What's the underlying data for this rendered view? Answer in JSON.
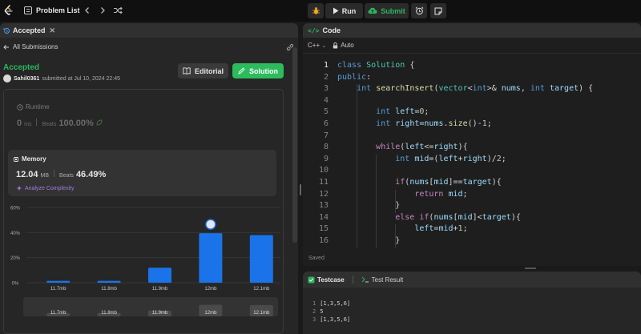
{
  "topbar": {
    "problem_list": "Problem List",
    "run_label": "Run",
    "submit_label": "Submit"
  },
  "left": {
    "tab_label": "Accepted",
    "all_submissions": "All Submissions",
    "status": "Accepted",
    "username": "Sahil0361",
    "submitted_text": "submitted at Jul 10, 2024 22:45",
    "editorial_label": "Editorial",
    "solution_label": "Solution",
    "runtime": {
      "label": "Runtime",
      "value": "0",
      "unit": "ms",
      "beats_label": "Beats",
      "beats_value": "100.00%"
    },
    "memory": {
      "label": "Memory",
      "value": "12.04",
      "unit": "MB",
      "beats_label": "Beats",
      "beats_value": "46.49%",
      "analyze": "Analyze Complexity"
    }
  },
  "chart_data": {
    "type": "bar",
    "categories": [
      "11.7mb",
      "11.8mb",
      "11.9mb",
      "12mb",
      "12.1mb"
    ],
    "values": [
      1.5,
      1.5,
      12,
      39.5,
      38
    ],
    "y_ticks": [
      "60%",
      "40%",
      "20%",
      "0%"
    ],
    "ylim": [
      0,
      60
    ],
    "highlight_index": 3,
    "bar_color": "#1a73e8",
    "grid": true
  },
  "code_panel": {
    "tab_label": "Code",
    "language": "C++",
    "mode": "Auto",
    "saved": "Saved",
    "lines": [
      {
        "n": "1",
        "text": "class Solution {"
      },
      {
        "n": "2",
        "text": "public:"
      },
      {
        "n": "3",
        "text": "    int searchInsert(vector<int>& nums, int target) {"
      },
      {
        "n": "4",
        "text": ""
      },
      {
        "n": "5",
        "text": "        int left=0;"
      },
      {
        "n": "6",
        "text": "        int right=nums.size()-1;"
      },
      {
        "n": "7",
        "text": ""
      },
      {
        "n": "8",
        "text": "        while(left<=right){"
      },
      {
        "n": "9",
        "text": "            int mid=(left+right)/2;"
      },
      {
        "n": "10",
        "text": ""
      },
      {
        "n": "11",
        "text": "            if(nums[mid]==target){"
      },
      {
        "n": "12",
        "text": "                return mid;"
      },
      {
        "n": "13",
        "text": "            }"
      },
      {
        "n": "14",
        "text": "            else if(nums[mid]<target){"
      },
      {
        "n": "15",
        "text": "                left=mid+1;"
      },
      {
        "n": "16",
        "text": "            }"
      }
    ]
  },
  "testcase": {
    "tab1": "Testcase",
    "tab2": "Test Result",
    "lines": [
      {
        "n": "1",
        "text": "[1,3,5,6]"
      },
      {
        "n": "2",
        "text": "5"
      },
      {
        "n": "3",
        "text": "[1,3,5,6]"
      }
    ]
  }
}
